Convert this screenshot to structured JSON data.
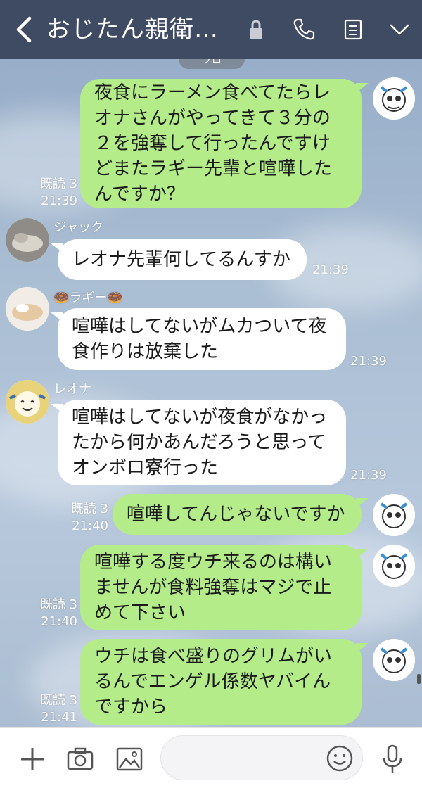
{
  "header": {
    "title": "おじたん親衛…",
    "icons": [
      "chevron-left-icon",
      "lock-icon",
      "phone-icon",
      "notes-icon",
      "chevron-down-icon"
    ],
    "color": "#3f4a63"
  },
  "peek_label": "プロ",
  "messages": [
    {
      "from": "me",
      "text": "夜食にラーメン食べてたらレ\nオナさんがやってきて３分の\n２を強奪して行ったんですけ\nどまたラギー先輩と喧嘩した\nんですか？",
      "read": "既読 3",
      "time": "21:39"
    },
    {
      "from": "them",
      "sender": "ジャック",
      "text": "レオナ先輩何してるんすか",
      "time": "21:39"
    },
    {
      "from": "them",
      "sender": "🍩ラギー🍩",
      "text": "喧嘩はしてないがムカついて夜\n食作りは放棄した",
      "time": "21:39"
    },
    {
      "from": "them",
      "sender": "レオナ",
      "text": "喧嘩はしてないが夜食がなかっ\nたから何かあんだろうと思って\nオンボロ寮行った",
      "time": "21:39"
    },
    {
      "from": "me",
      "text": "喧嘩してんじゃないですか",
      "read": "既読 3",
      "time": "21:40"
    },
    {
      "from": "me",
      "text": "喧嘩する度ウチ来るのは構い\nませんが食料強奪はマジで止\nめて下さい",
      "read": "既読 3",
      "time": "21:40"
    },
    {
      "from": "me",
      "text": "ウチは食べ盛りのグリムがい\nるんでエンゲル係数ヤバイん\nですから",
      "read": "既読 3",
      "time": "21:41"
    }
  ],
  "bottom_bar": {
    "icons": [
      "plus-icon",
      "camera-icon",
      "image-icon",
      "emoji-icon",
      "microphone-icon"
    ],
    "input_placeholder": ""
  },
  "colors": {
    "my_bubble": "#b5ec8a",
    "their_bubble": "#ffffff",
    "background": "#a9bdd3"
  }
}
